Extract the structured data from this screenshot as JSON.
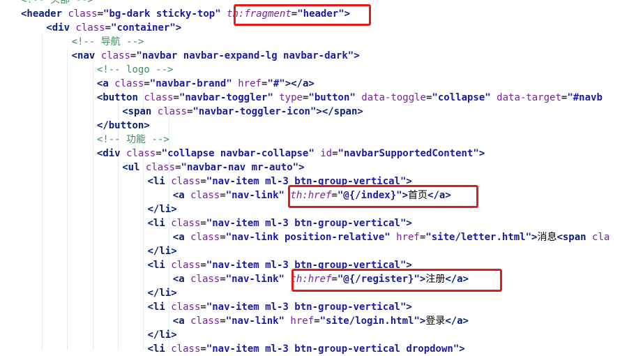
{
  "lines": [
    {
      "indent": 1,
      "tokens": [
        [
          "com",
          "<!-- 头部 -->"
        ]
      ]
    },
    {
      "indent": 1,
      "tokens": [
        [
          "tag",
          "<header"
        ],
        [
          "txt",
          " "
        ],
        [
          "attr",
          "class"
        ],
        [
          "eq",
          "="
        ],
        [
          "val",
          "\"bg-dark sticky-top\""
        ],
        [
          "txt",
          " "
        ],
        [
          "th",
          "th:fragment"
        ],
        [
          "eq",
          "="
        ],
        [
          "val",
          "\"header\""
        ],
        [
          "tag",
          ">"
        ]
      ]
    },
    {
      "indent": 2,
      "tokens": [
        [
          "tag",
          "<div"
        ],
        [
          "txt",
          " "
        ],
        [
          "attr",
          "class"
        ],
        [
          "eq",
          "="
        ],
        [
          "val",
          "\"container\""
        ],
        [
          "tag",
          ">"
        ]
      ]
    },
    {
      "indent": 3,
      "tokens": [
        [
          "com",
          "<!-- 导航 -->"
        ]
      ]
    },
    {
      "indent": 3,
      "tokens": [
        [
          "tag",
          "<nav"
        ],
        [
          "txt",
          " "
        ],
        [
          "attr",
          "class"
        ],
        [
          "eq",
          "="
        ],
        [
          "val",
          "\"navbar navbar-expand-lg navbar-dark\""
        ],
        [
          "tag",
          ">"
        ]
      ]
    },
    {
      "indent": 4,
      "tokens": [
        [
          "com",
          "<!-- logo -->"
        ]
      ]
    },
    {
      "indent": 4,
      "tokens": [
        [
          "tag",
          "<a"
        ],
        [
          "txt",
          " "
        ],
        [
          "attr",
          "class"
        ],
        [
          "eq",
          "="
        ],
        [
          "val",
          "\"navbar-brand\""
        ],
        [
          "txt",
          " "
        ],
        [
          "attr",
          "href"
        ],
        [
          "eq",
          "="
        ],
        [
          "val",
          "\"#\""
        ],
        [
          "tag",
          ">"
        ],
        [
          "tag",
          "</a>"
        ]
      ]
    },
    {
      "indent": 4,
      "tokens": [
        [
          "tag",
          "<button"
        ],
        [
          "txt",
          " "
        ],
        [
          "attr",
          "class"
        ],
        [
          "eq",
          "="
        ],
        [
          "val",
          "\"navbar-toggler\""
        ],
        [
          "txt",
          " "
        ],
        [
          "attr",
          "type"
        ],
        [
          "eq",
          "="
        ],
        [
          "val",
          "\"button\""
        ],
        [
          "txt",
          " "
        ],
        [
          "attr",
          "data-toggle"
        ],
        [
          "eq",
          "="
        ],
        [
          "val",
          "\"collapse\""
        ],
        [
          "txt",
          " "
        ],
        [
          "attr",
          "data-target"
        ],
        [
          "eq",
          "="
        ],
        [
          "val",
          "\"#navb"
        ]
      ]
    },
    {
      "indent": 5,
      "tokens": [
        [
          "tag",
          "<span"
        ],
        [
          "txt",
          " "
        ],
        [
          "attr",
          "class"
        ],
        [
          "eq",
          "="
        ],
        [
          "val",
          "\"navbar-toggler-icon\""
        ],
        [
          "tag",
          ">"
        ],
        [
          "tag",
          "</span>"
        ]
      ]
    },
    {
      "indent": 4,
      "tokens": [
        [
          "tag",
          "</button>"
        ]
      ]
    },
    {
      "indent": 4,
      "tokens": [
        [
          "com",
          "<!-- 功能 -->"
        ]
      ]
    },
    {
      "indent": 4,
      "tokens": [
        [
          "tag",
          "<div"
        ],
        [
          "txt",
          " "
        ],
        [
          "attr",
          "class"
        ],
        [
          "eq",
          "="
        ],
        [
          "val",
          "\"collapse navbar-collapse\""
        ],
        [
          "txt",
          " "
        ],
        [
          "attr",
          "id"
        ],
        [
          "eq",
          "="
        ],
        [
          "val",
          "\"navbarSupportedContent\""
        ],
        [
          "tag",
          ">"
        ]
      ]
    },
    {
      "indent": 5,
      "tokens": [
        [
          "tag",
          "<ul"
        ],
        [
          "txt",
          " "
        ],
        [
          "attr",
          "class"
        ],
        [
          "eq",
          "="
        ],
        [
          "val",
          "\"navbar-nav mr-auto\""
        ],
        [
          "tag",
          ">"
        ]
      ]
    },
    {
      "indent": 6,
      "tokens": [
        [
          "tag",
          "<li"
        ],
        [
          "txt",
          " "
        ],
        [
          "attr",
          "class"
        ],
        [
          "eq",
          "="
        ],
        [
          "val",
          "\"nav-item ml-3 btn-group-vertical\""
        ],
        [
          "tag",
          ">"
        ]
      ]
    },
    {
      "indent": 7,
      "tokens": [
        [
          "tag",
          "<a"
        ],
        [
          "txt",
          " "
        ],
        [
          "attr",
          "class"
        ],
        [
          "eq",
          "="
        ],
        [
          "val",
          "\"nav-link\""
        ],
        [
          "txt",
          " "
        ],
        [
          "th",
          "th:href"
        ],
        [
          "eq",
          "="
        ],
        [
          "val",
          "\"@{/index}\""
        ],
        [
          "tag",
          ">"
        ],
        [
          "txt",
          "首页"
        ],
        [
          "tag",
          "</a>"
        ]
      ]
    },
    {
      "indent": 6,
      "tokens": [
        [
          "tag",
          "</li>"
        ]
      ]
    },
    {
      "indent": 6,
      "tokens": [
        [
          "tag",
          "<li"
        ],
        [
          "txt",
          " "
        ],
        [
          "attr",
          "class"
        ],
        [
          "eq",
          "="
        ],
        [
          "val",
          "\"nav-item ml-3 btn-group-vertical\""
        ],
        [
          "tag",
          ">"
        ]
      ]
    },
    {
      "indent": 7,
      "tokens": [
        [
          "tag",
          "<a"
        ],
        [
          "txt",
          " "
        ],
        [
          "attr",
          "class"
        ],
        [
          "eq",
          "="
        ],
        [
          "val",
          "\"nav-link position-relative\""
        ],
        [
          "txt",
          " "
        ],
        [
          "attr",
          "href"
        ],
        [
          "eq",
          "="
        ],
        [
          "val",
          "\"site/letter.html\""
        ],
        [
          "tag",
          ">"
        ],
        [
          "txt",
          "消息"
        ],
        [
          "tag",
          "<span"
        ],
        [
          "txt",
          " "
        ],
        [
          "attr",
          "cla"
        ]
      ]
    },
    {
      "indent": 6,
      "tokens": [
        [
          "tag",
          "</li>"
        ]
      ]
    },
    {
      "indent": 6,
      "tokens": [
        [
          "tag",
          "<li"
        ],
        [
          "txt",
          " "
        ],
        [
          "attr",
          "class"
        ],
        [
          "eq",
          "="
        ],
        [
          "val",
          "\"nav-item ml-3 btn-group-vertical\""
        ],
        [
          "tag",
          ">"
        ]
      ]
    },
    {
      "indent": 7,
      "tokens": [
        [
          "tag",
          "<a"
        ],
        [
          "txt",
          " "
        ],
        [
          "attr",
          "class"
        ],
        [
          "eq",
          "="
        ],
        [
          "val",
          "\"nav-link\""
        ],
        [
          "txt",
          " "
        ],
        [
          "th",
          "th:href"
        ],
        [
          "eq",
          "="
        ],
        [
          "val",
          "\"@{/register}\""
        ],
        [
          "tag",
          ">"
        ],
        [
          "txt",
          "注册"
        ],
        [
          "tag",
          "</a>"
        ]
      ]
    },
    {
      "indent": 6,
      "tokens": [
        [
          "tag",
          "</li>"
        ]
      ]
    },
    {
      "indent": 6,
      "tokens": [
        [
          "tag",
          "<li"
        ],
        [
          "txt",
          " "
        ],
        [
          "attr",
          "class"
        ],
        [
          "eq",
          "="
        ],
        [
          "val",
          "\"nav-item ml-3 btn-group-vertical\""
        ],
        [
          "tag",
          ">"
        ]
      ]
    },
    {
      "indent": 7,
      "tokens": [
        [
          "tag",
          "<a"
        ],
        [
          "txt",
          " "
        ],
        [
          "attr",
          "class"
        ],
        [
          "eq",
          "="
        ],
        [
          "val",
          "\"nav-link\""
        ],
        [
          "txt",
          " "
        ],
        [
          "attr",
          "href"
        ],
        [
          "eq",
          "="
        ],
        [
          "val",
          "\"site/login.html\""
        ],
        [
          "tag",
          ">"
        ],
        [
          "txt",
          "登录"
        ],
        [
          "tag",
          "</a>"
        ]
      ]
    },
    {
      "indent": 6,
      "tokens": [
        [
          "tag",
          "</li>"
        ]
      ]
    },
    {
      "indent": 6,
      "tokens": [
        [
          "tag",
          "<li"
        ],
        [
          "txt",
          " "
        ],
        [
          "attr",
          "class"
        ],
        [
          "eq",
          "="
        ],
        [
          "val",
          "\"nav-item ml-3 btn-group-vertical dropdown\""
        ],
        [
          "tag",
          ">"
        ]
      ]
    }
  ],
  "highlight_color": "#e01b1b"
}
